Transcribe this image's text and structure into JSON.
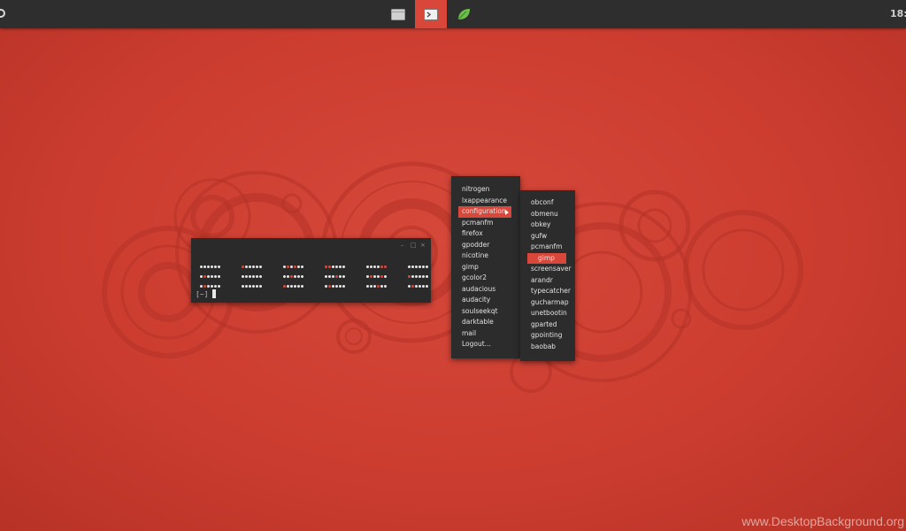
{
  "taskbar": {
    "clock": "18:",
    "tasks": [
      {
        "icon": "folder-icon",
        "active": false
      },
      {
        "icon": "terminal-icon",
        "active": true
      },
      {
        "icon": "leaf-icon",
        "active": false
      }
    ]
  },
  "terminal": {
    "window_buttons": [
      "–",
      "□",
      "×"
    ],
    "prompt": "[~]"
  },
  "menu": {
    "items": [
      "nitrogen",
      "lxappearance",
      "configuration",
      "pcmanfm",
      "firefox",
      "gpodder",
      "nicotine",
      "gimp",
      "gcolor2",
      "audacious",
      "audacity",
      "soulseekqt",
      "darktable",
      "mail",
      "Logout..."
    ],
    "selected": "configuration"
  },
  "submenu": {
    "items": [
      "obconf",
      "obmenu",
      "obkey",
      "gufw",
      "pcmanfm",
      "gimp",
      "screensaver",
      "arandr",
      "typecatcher",
      "gucharmap",
      "unetbootin",
      "gparted",
      "gpointing",
      "baobab"
    ],
    "selected": "gimp"
  },
  "colors": {
    "accent": "#d9473a",
    "panel": "#2e2e2e",
    "background": "#cc3d30"
  },
  "watermark": "www.DesktopBackground.org"
}
